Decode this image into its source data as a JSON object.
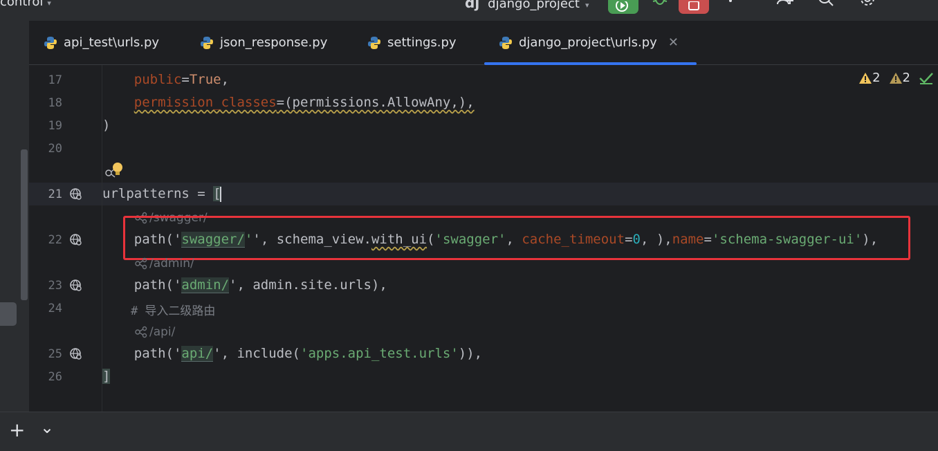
{
  "toolbar": {
    "vcs_label": "control",
    "project_name": "django_project",
    "project_logo": "dj"
  },
  "tabs": [
    {
      "label": "api_test\\urls.py",
      "active": false
    },
    {
      "label": "json_response.py",
      "active": false
    },
    {
      "label": "settings.py",
      "active": false
    },
    {
      "label": "django_project\\urls.py",
      "active": true
    }
  ],
  "editor": {
    "inspections": {
      "warnings_a": "2",
      "warnings_b": "2"
    },
    "line_numbers": [
      "17",
      "18",
      "19",
      "20",
      "21",
      "22",
      "23",
      "24",
      "25",
      "26"
    ],
    "hints": {
      "swagger": "/swagger/",
      "admin": "/admin/",
      "api": "/api/"
    },
    "code": {
      "l17_param": "public",
      "l17_eq": "=",
      "l17_val": "True",
      "l17_end": ",",
      "l18_param": "permission_classes",
      "l18_rest": "=(permissions.AllowAny,),",
      "l19": ")",
      "l21_a": "urlpatterns = ",
      "l21_b": "[",
      "l22_a": "path('",
      "l22_s1": "swagger/",
      "l22_b": "', schema_view.",
      "l22_fn": "with_ui",
      "l22_c": "(",
      "l22_s2": "'swagger'",
      "l22_d": ", ",
      "l22_p1": "cache_timeout",
      "l22_e": "=",
      "l22_n": "0",
      "l22_f": ", ),",
      "l22_p2": "name",
      "l22_g": "=",
      "l22_s3": "'schema-swagger-ui'",
      "l22_h": "),",
      "l23_a": "path('",
      "l23_s": "admin/",
      "l23_b": "', admin.site.urls),",
      "l24": "# 导入二级路由",
      "l25_a": "path('",
      "l25_s": "api/",
      "l25_b": "', include(",
      "l25_s2": "'apps.api_test.urls'",
      "l25_c": ")),",
      "l26": "]"
    }
  },
  "bottom": {
    "add_label": "+",
    "chevron": "⌄"
  },
  "colors": {
    "accent": "#3574f0",
    "highlight_box": "#e8333b",
    "run": "#499c54",
    "stop": "#c94f4f"
  }
}
